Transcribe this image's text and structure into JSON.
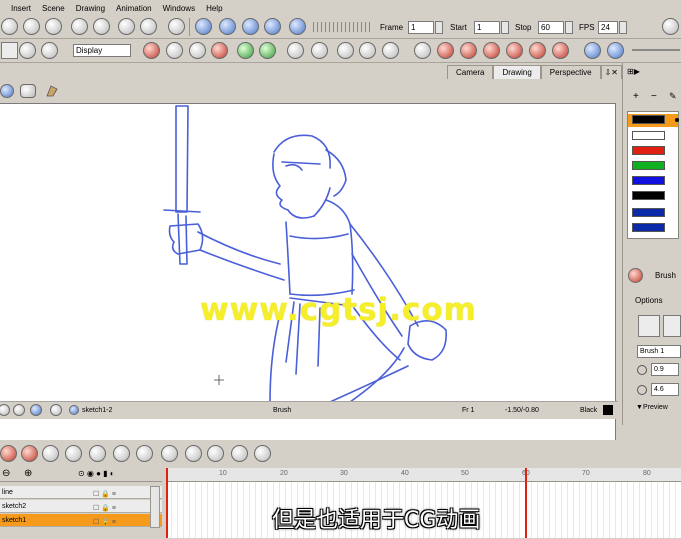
{
  "menu": [
    "Insert",
    "Scene",
    "Drawing",
    "Animation",
    "Windows",
    "Help"
  ],
  "toolbar": {
    "frame_label": "Frame",
    "frame_value": "1",
    "start_label": "Start",
    "start_value": "1",
    "stop_label": "Stop",
    "stop_value": "60",
    "fps_label": "FPS",
    "fps_value": "24",
    "display_select": "Display"
  },
  "view_tabs": [
    "Camera",
    "Drawing",
    "Perspective"
  ],
  "active_tab": "Drawing",
  "status": {
    "layer": "sketch1-2",
    "tool": "Brush",
    "frame": "Fr 1",
    "coords": "-1.50/-0.80",
    "color_name": "Black"
  },
  "right_panel": {
    "swatch_colors": [
      "#000000",
      "#ffffff",
      "#e02010",
      "#10b020",
      "#1010e0",
      "#000000",
      "#0a2aa8",
      "#0a2aa8"
    ],
    "tool_label": "Brush",
    "options_label": "Options",
    "brush_name": "Brush 1",
    "min_size": "0.9",
    "max_size": "4.6",
    "preview_label": "Preview"
  },
  "timeline": {
    "layers": [
      "line",
      "sketch2",
      "sketch1"
    ],
    "selected_layer": "sketch1",
    "ruler_ticks": [
      "10",
      "20",
      "30",
      "40",
      "50",
      "60",
      "70",
      "80"
    ]
  },
  "overlay": {
    "watermark": "www.cgtsj.com",
    "subtitle": "但是也适用于CG动画"
  },
  "colors": {
    "selection": "#f59a1a",
    "sketch_line": "#4a5fd8",
    "watermark": "#f5ee2a"
  }
}
